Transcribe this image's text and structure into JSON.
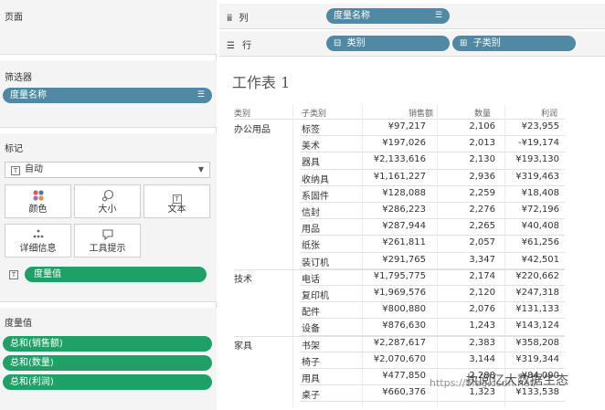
{
  "left_panel": {
    "pages_title": "页面",
    "filters_title": "筛选器",
    "filter_pill": "度量名称",
    "marks_title": "标记",
    "marks_type": "自动",
    "mark_buttons": [
      "颜色",
      "大小",
      "文本",
      "详细信息",
      "工具提示"
    ],
    "measure_values_pill": "度量值",
    "measure_values_title": "度量值",
    "measure_pills": [
      "总和(销售额)",
      "总和(数量)",
      "总和(利润)"
    ]
  },
  "shelves": {
    "columns_label": "列",
    "columns_pill": "度量名称",
    "rows_label": "行",
    "rows_pills": [
      "类别",
      "子类别"
    ]
  },
  "sheet": {
    "title": "工作表 1",
    "headers": [
      "类别",
      "子类别",
      "销售额",
      "数量",
      "利润"
    ],
    "groups": [
      {
        "category": "办公用品",
        "rows": [
          {
            "sub": "标签",
            "sales": "¥97,217",
            "qty": "2,106",
            "profit": "¥23,955"
          },
          {
            "sub": "美术",
            "sales": "¥197,026",
            "qty": "2,013",
            "profit": "-¥19,174"
          },
          {
            "sub": "器具",
            "sales": "¥2,133,616",
            "qty": "2,130",
            "profit": "¥193,130"
          },
          {
            "sub": "收纳具",
            "sales": "¥1,161,227",
            "qty": "2,936",
            "profit": "¥319,463"
          },
          {
            "sub": "系固件",
            "sales": "¥128,088",
            "qty": "2,259",
            "profit": "¥18,408"
          },
          {
            "sub": "信封",
            "sales": "¥286,223",
            "qty": "2,276",
            "profit": "¥72,196"
          },
          {
            "sub": "用品",
            "sales": "¥287,944",
            "qty": "2,265",
            "profit": "¥40,408"
          },
          {
            "sub": "纸张",
            "sales": "¥261,811",
            "qty": "2,057",
            "profit": "¥61,256"
          },
          {
            "sub": "装订机",
            "sales": "¥291,765",
            "qty": "3,347",
            "profit": "¥42,501"
          }
        ]
      },
      {
        "category": "技术",
        "rows": [
          {
            "sub": "电话",
            "sales": "¥1,795,775",
            "qty": "2,174",
            "profit": "¥220,662"
          },
          {
            "sub": "复印机",
            "sales": "¥1,969,576",
            "qty": "2,120",
            "profit": "¥247,318"
          },
          {
            "sub": "配件",
            "sales": "¥800,880",
            "qty": "2,076",
            "profit": "¥131,133"
          },
          {
            "sub": "设备",
            "sales": "¥876,630",
            "qty": "1,243",
            "profit": "¥143,124"
          }
        ]
      },
      {
        "category": "家具",
        "rows": [
          {
            "sub": "书架",
            "sales": "¥2,287,617",
            "qty": "2,383",
            "profit": "¥358,208"
          },
          {
            "sub": "椅子",
            "sales": "¥2,070,670",
            "qty": "3,144",
            "profit": "¥319,344"
          },
          {
            "sub": "用具",
            "sales": "¥477,850",
            "qty": "2,288",
            "profit": "¥84,090"
          },
          {
            "sub": "桌子",
            "sales": "¥660,376",
            "qty": "1,323",
            "profit": "¥133,538"
          }
        ]
      }
    ]
  },
  "watermark": {
    "url": "https://blog.csdn.net/",
    "account": "执阅亿大数据生态"
  }
}
